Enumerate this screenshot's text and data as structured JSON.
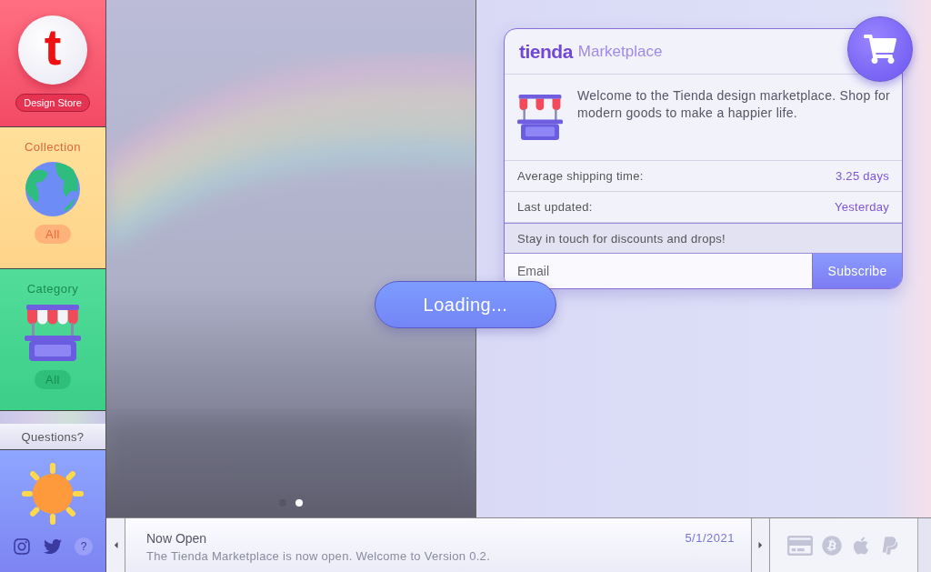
{
  "brand": {
    "logo_letter": "t",
    "badge": "Design Store"
  },
  "sidebar": [
    {
      "kind": "collection",
      "title": "Collection",
      "button": "All"
    },
    {
      "kind": "category",
      "title": "Category",
      "button": "All"
    }
  ],
  "questions": {
    "title": "Questions?",
    "help": "?"
  },
  "hero": {
    "slides": [
      {
        "selected": false
      },
      {
        "selected": true
      }
    ]
  },
  "loading": "Loading...",
  "card": {
    "logo": "tienda",
    "title": "Marketplace",
    "welcome": "Welcome to the Tienda design marketplace. Shop for modern goods to make a happier life.",
    "stats": [
      {
        "label": "Average shipping time:",
        "value": "3.25 days"
      },
      {
        "label": "Last updated:",
        "value": "Yesterday"
      }
    ],
    "newsletter": "Stay in touch for discounts and drops!",
    "email": {
      "placeholder": "Email"
    },
    "subscribe": "Subscribe"
  },
  "news": {
    "title": "Now Open",
    "date": "5/1/2021",
    "text": "The Tienda Marketplace is now open. Welcome to Version 0.2."
  }
}
